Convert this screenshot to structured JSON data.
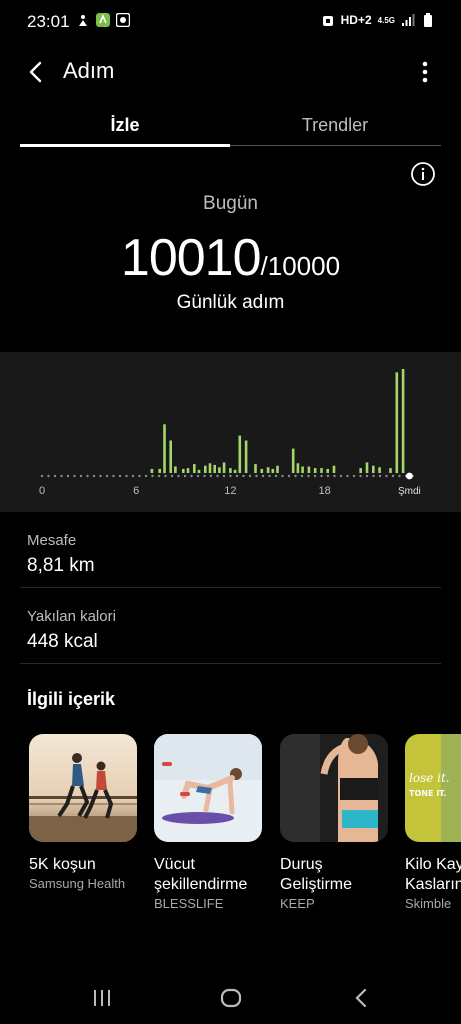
{
  "status_bar": {
    "time": "23:01",
    "network": "HD+2",
    "network_type": "4.5G"
  },
  "header": {
    "title": "Adım"
  },
  "tabs": [
    {
      "label": "İzle",
      "active": true
    },
    {
      "label": "Trendler",
      "active": false
    }
  ],
  "summary": {
    "day_label": "Bugün",
    "steps": "10010",
    "goal": "/10000",
    "caption": "Günlük adım"
  },
  "chart_data": {
    "type": "bar",
    "x_ticks": [
      "0",
      "6",
      "12",
      "18",
      "Şmdi"
    ],
    "x_tick_positions": [
      0,
      6,
      12,
      18,
      23.4
    ],
    "bar_hours": [
      7,
      7.5,
      7.8,
      8.2,
      8.5,
      9,
      9.3,
      9.7,
      10,
      10.4,
      10.7,
      11,
      11.3,
      11.6,
      12,
      12.3,
      12.6,
      13,
      13.6,
      14,
      14.4,
      14.7,
      15,
      16,
      16.3,
      16.6,
      17,
      17.4,
      17.8,
      18.2,
      18.6,
      20.3,
      20.7,
      21.1,
      21.5,
      22.2,
      22.6,
      23
    ],
    "values": [
      5,
      5,
      60,
      40,
      8,
      5,
      6,
      11,
      4,
      9,
      12,
      10,
      7,
      13,
      6,
      4,
      46,
      40,
      11,
      5,
      7,
      5,
      9,
      30,
      12,
      8,
      8,
      6,
      6,
      5,
      9,
      6,
      13,
      9,
      7,
      6,
      124,
      128
    ],
    "bar_color": "#a5d66c"
  },
  "stats": [
    {
      "label": "Mesafe",
      "value": "8,81 km"
    },
    {
      "label": "Yakılan kalori",
      "value": "448 kcal"
    }
  ],
  "related": {
    "title": "İlgili içerik",
    "cards": [
      {
        "title": "5K koşun",
        "title2": "",
        "subtitle": "Samsung Health"
      },
      {
        "title": "Vücut",
        "title2": "şekillendirme",
        "subtitle": "BLESSLIFE"
      },
      {
        "title": "Duruş",
        "title2": "Geliştirme",
        "subtitle": "KEEP"
      },
      {
        "title": "Kilo Kay",
        "title2": "Kasların",
        "subtitle": "Skimble"
      }
    ],
    "card4_image_text": [
      "lose it.",
      "TONE IT."
    ]
  }
}
